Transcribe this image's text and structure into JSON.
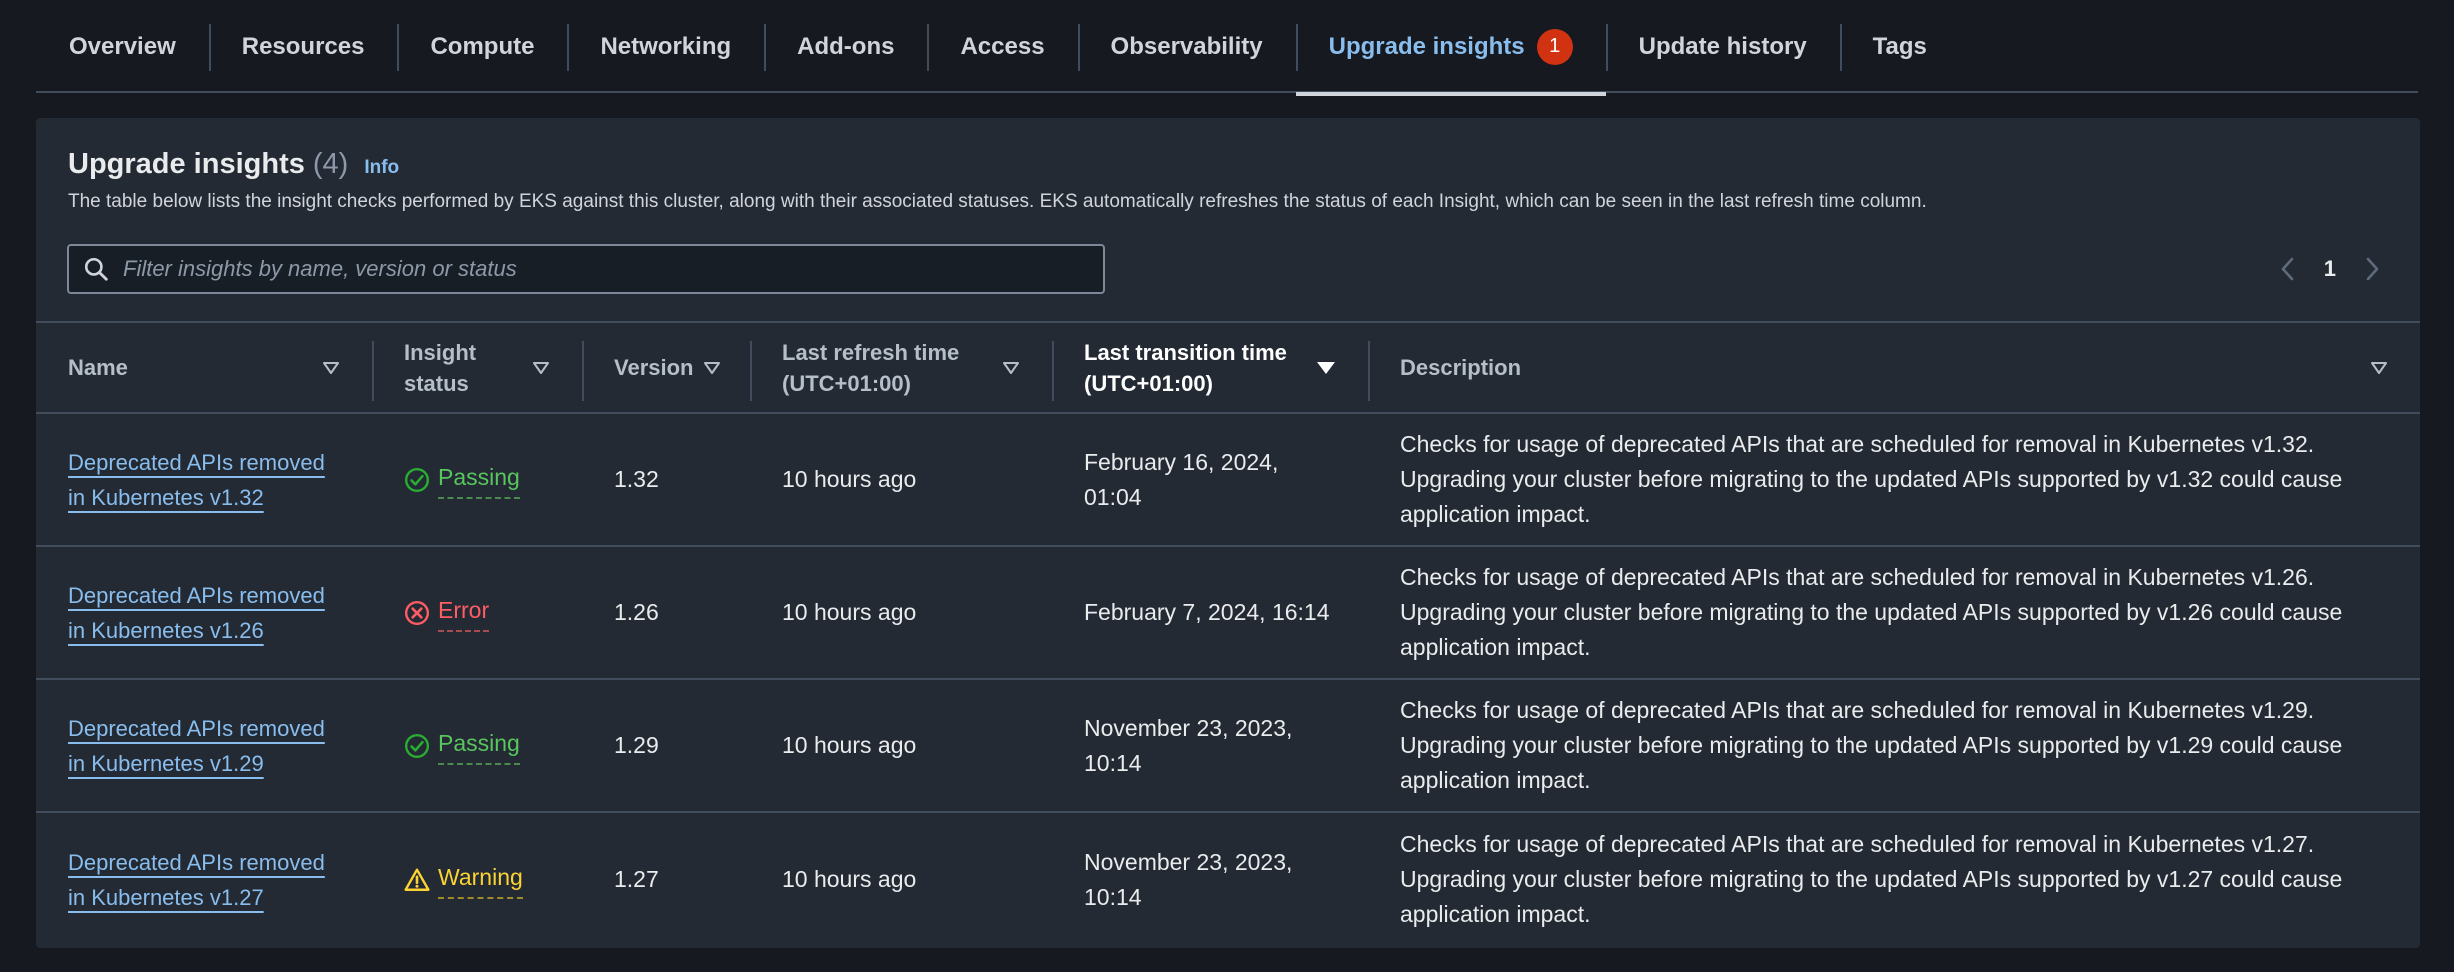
{
  "tabs": [
    {
      "label": "Overview"
    },
    {
      "label": "Resources"
    },
    {
      "label": "Compute"
    },
    {
      "label": "Networking"
    },
    {
      "label": "Add-ons"
    },
    {
      "label": "Access"
    },
    {
      "label": "Observability"
    },
    {
      "label": "Upgrade insights",
      "badge": "1",
      "active": true
    },
    {
      "label": "Update history"
    },
    {
      "label": "Tags"
    }
  ],
  "panel": {
    "title": "Upgrade insights",
    "count": "(4)",
    "info": "Info",
    "description": "The table below lists the insight checks performed by EKS against this cluster, along with their associated statuses. EKS automatically refreshes the status of each Insight, which can be seen in the last refresh time column."
  },
  "search": {
    "placeholder": "Filter insights by name, version or status",
    "value": ""
  },
  "pagination": {
    "current_page": "1"
  },
  "table": {
    "columns": {
      "name": "Name",
      "status": "Insight status",
      "version": "Version",
      "refresh": "Last refresh time (UTC+01:00)",
      "transition": "Last transition time (UTC+01:00)",
      "description": "Description"
    },
    "rows": [
      {
        "name": "Deprecated APIs removed in Kubernetes v1.32",
        "status": "Passing",
        "version": "1.32",
        "refresh": "10 hours ago",
        "transition": "February 16, 2024, 01:04",
        "description": "Checks for usage of deprecated APIs that are scheduled for removal in Kubernetes v1.32. Upgrading your cluster before migrating to the updated APIs supported by v1.32 could cause application impact."
      },
      {
        "name": "Deprecated APIs removed in Kubernetes v1.26",
        "status": "Error",
        "version": "1.26",
        "refresh": "10 hours ago",
        "transition": "February 7, 2024, 16:14",
        "description": "Checks for usage of deprecated APIs that are scheduled for removal in Kubernetes v1.26. Upgrading your cluster before migrating to the updated APIs supported by v1.26 could cause application impact."
      },
      {
        "name": "Deprecated APIs removed in Kubernetes v1.29",
        "status": "Passing",
        "version": "1.29",
        "refresh": "10 hours ago",
        "transition": "November 23, 2023, 10:14",
        "description": "Checks for usage of deprecated APIs that are scheduled for removal in Kubernetes v1.29. Upgrading your cluster before migrating to the updated APIs supported by v1.29 could cause application impact."
      },
      {
        "name": "Deprecated APIs removed in Kubernetes v1.27",
        "status": "Warning",
        "version": "1.27",
        "refresh": "10 hours ago",
        "transition": "November 23, 2023, 10:14",
        "description": "Checks for usage of deprecated APIs that are scheduled for removal in Kubernetes v1.27. Upgrading your cluster before migrating to the updated APIs supported by v1.27 could cause application impact."
      }
    ]
  },
  "icons": {
    "search": "search-icon",
    "passing": "check-circle-icon",
    "error": "x-circle-icon",
    "warning": "warning-triangle-icon",
    "sort": "caret-down-icon",
    "pager_prev": "chevron-left-icon",
    "pager_next": "chevron-right-icon"
  },
  "colors": {
    "background": "#16191f",
    "panel": "#232a33",
    "link": "#89bdee",
    "passing": "#29ad32",
    "error": "#ff5d64",
    "warning": "#fbd332",
    "badge": "#d13212"
  }
}
